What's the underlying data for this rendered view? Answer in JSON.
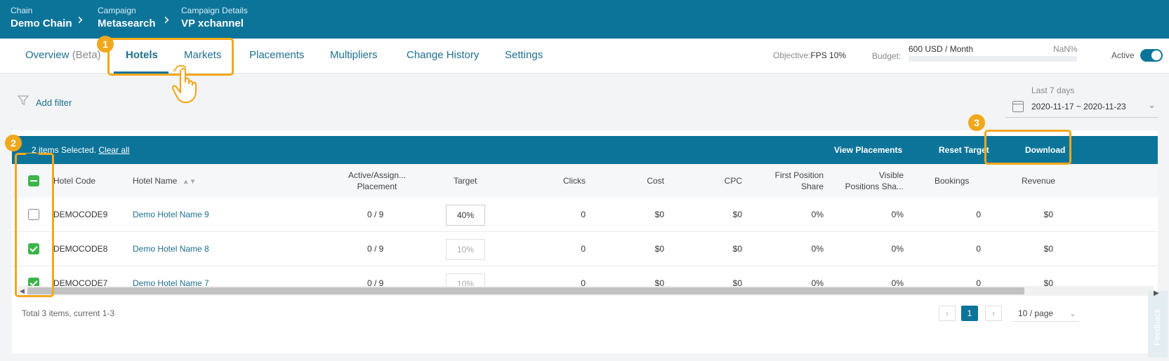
{
  "breadcrumb": [
    {
      "label": "Chain",
      "value": "Demo Chain"
    },
    {
      "label": "Campaign",
      "value": "Metasearch"
    },
    {
      "label": "Campaign Details",
      "value": "VP xchannel"
    }
  ],
  "tabs": {
    "overview": "Overview",
    "overview_beta": "(Beta)",
    "hotels": "Hotels",
    "markets": "Markets",
    "placements": "Placements",
    "multipliers": "Multipliers",
    "change_history": "Change History",
    "settings": "Settings"
  },
  "header_info": {
    "objective_label": "Objective:",
    "objective_value": "FPS 10%",
    "budget_label": "Budget:",
    "budget_value": "600 USD / Month",
    "budget_pct": "NaN%",
    "active_label": "Active",
    "active_on": true
  },
  "filters": {
    "add_filter": "Add filter",
    "date_range_label": "Last 7 days",
    "date_range": "2020-11-17 ~ 2020-11-23"
  },
  "action_bar": {
    "selected_text": "2 items Selected.",
    "clear_all": "Clear all",
    "view_placements": "View Placements",
    "reset_target": "Reset Target",
    "download": "Download"
  },
  "table": {
    "columns": {
      "hotel_code": "Hotel Code",
      "hotel_name": "Hotel Name",
      "active_line1": "Active/Assign...",
      "active_line2": "Placement",
      "target": "Target",
      "clicks": "Clicks",
      "cost": "Cost",
      "cpc": "CPC",
      "fps_line1": "First Position",
      "fps_line2": "Share",
      "vps_line1": "Visible",
      "vps_line2": "Positions Sha...",
      "bookings": "Bookings",
      "revenue": "Revenue"
    },
    "rows": [
      {
        "code": "DEMOCODE9",
        "name": "Demo Hotel Name 9",
        "placement": "0 / 9",
        "target": "40%",
        "clicks": "0",
        "cost": "$0",
        "cpc": "$0",
        "fps": "0%",
        "vps": "0%",
        "bookings": "0",
        "revenue": "$0",
        "checked": false
      },
      {
        "code": "DEMOCODE8",
        "name": "Demo Hotel Name 8",
        "placement": "0 / 9",
        "target": "10%",
        "clicks": "0",
        "cost": "$0",
        "cpc": "$0",
        "fps": "0%",
        "vps": "0%",
        "bookings": "0",
        "revenue": "$0",
        "checked": true
      },
      {
        "code": "DEMOCODE7",
        "name": "Demo Hotel Name 7",
        "placement": "0 / 9",
        "target": "10%",
        "clicks": "0",
        "cost": "$0",
        "cpc": "$0",
        "fps": "0%",
        "vps": "0%",
        "bookings": "0",
        "revenue": "$0",
        "checked": true
      }
    ]
  },
  "pagination": {
    "total_text": "Total 3 items, current 1-3",
    "current_page": "1",
    "per_page": "10 / page"
  },
  "feedback": "Feedback",
  "tutorial": {
    "badge1": "1",
    "badge2": "2",
    "badge3": "3",
    "accent": "#f2a81d"
  },
  "colors": {
    "brand": "#0d7499",
    "check": "#3bb54a"
  }
}
